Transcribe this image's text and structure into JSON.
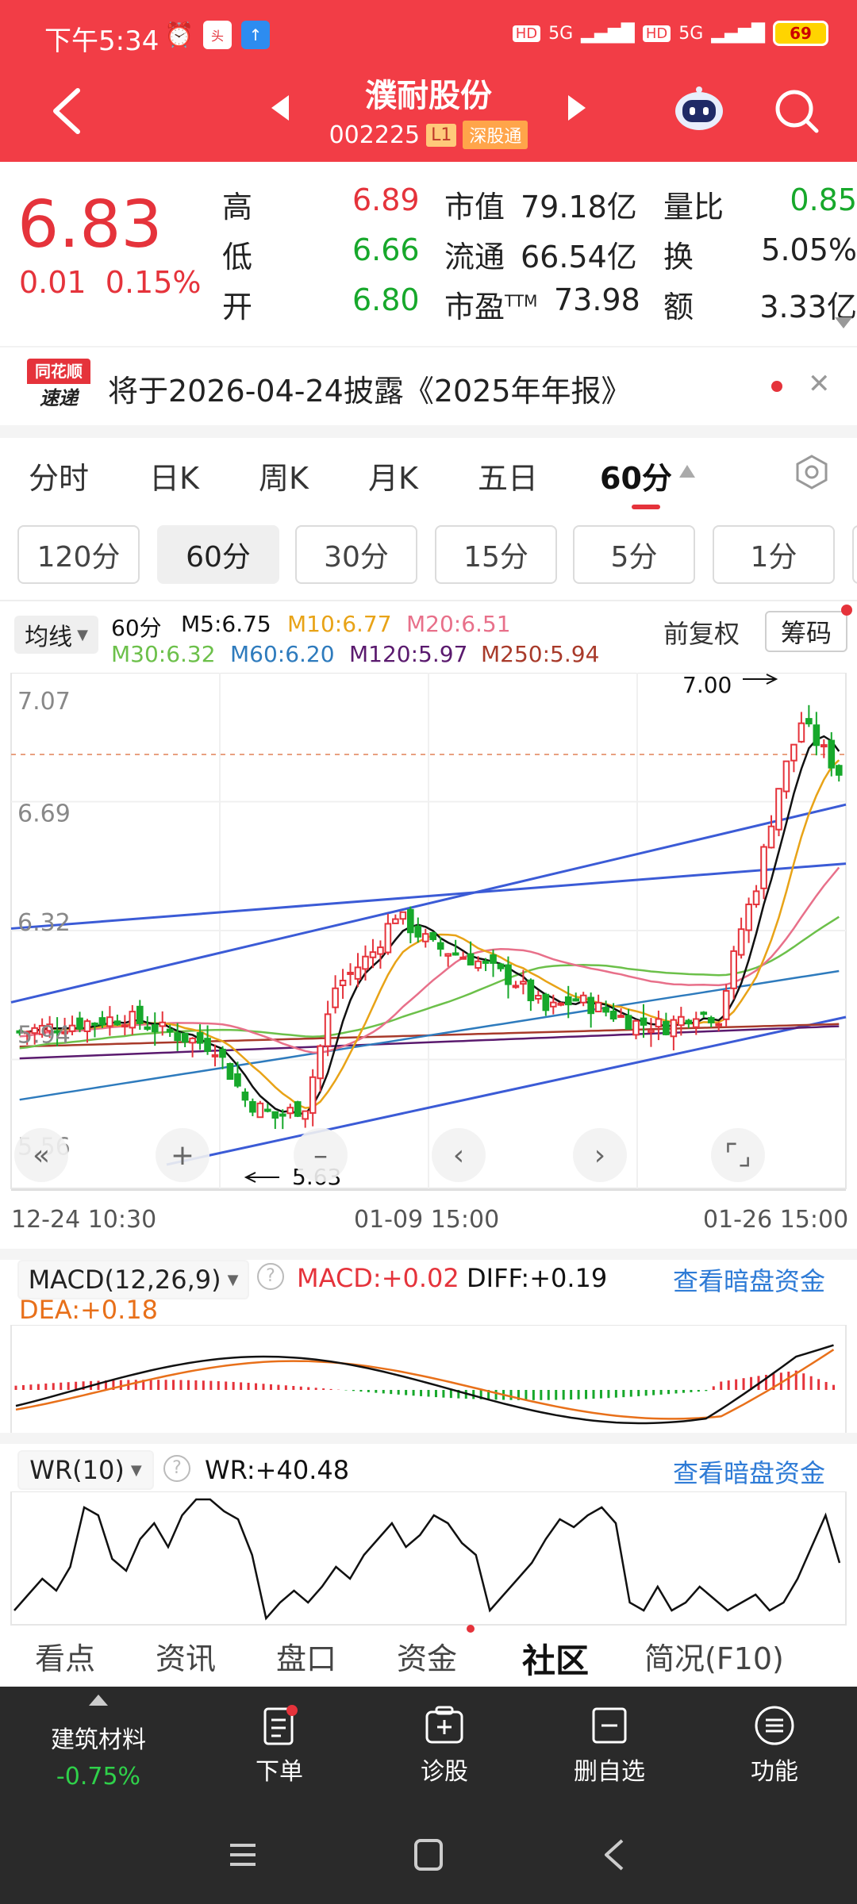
{
  "status_bar": {
    "time": "下午5:34",
    "signal1": "5G",
    "signal2": "5G",
    "battery": "69"
  },
  "header": {
    "title": "濮耐股份",
    "code": "002225",
    "level_badge": "L1",
    "exchange_badge": "深股通"
  },
  "quote": {
    "price": "6.83",
    "change": "0.01",
    "change_pct": "0.15%",
    "high_label": "高",
    "high": "6.89",
    "low_label": "低",
    "low": "6.66",
    "open_label": "开",
    "open": "6.80",
    "mktcap_label": "市值",
    "mktcap": "79.18亿",
    "float_label": "流通",
    "float": "66.54亿",
    "pe_label": "市盈",
    "pe_sup": "TTM",
    "pe": "73.98",
    "volratio_label": "量比",
    "volratio": "0.85",
    "turnover_label": "换",
    "turnover": "5.05%",
    "amount_label": "额",
    "amount": "3.33亿"
  },
  "notice": {
    "logo_top": "同花顺",
    "logo_bottom": "速递",
    "text": "将于2026-04-24披露《2025年年报》"
  },
  "period_tabs": [
    "分时",
    "日K",
    "周K",
    "月K",
    "五日",
    "60分"
  ],
  "sub_tabs": [
    "120分",
    "60分",
    "30分",
    "15分",
    "5分",
    "1分"
  ],
  "legend": {
    "avg_label": "均线",
    "period": "60分",
    "m5": "M5:6.75",
    "m10": "M10:6.77",
    "m20": "M20:6.51",
    "m30": "M30:6.32",
    "m60": "M60:6.20",
    "m120": "M120:5.97",
    "m250": "M250:5.94",
    "adjust": "前复权",
    "chips": "筹码"
  },
  "kline": {
    "yticks": [
      "7.07",
      "6.69",
      "6.32",
      "5.94",
      "5.56"
    ],
    "max_label": "7.00",
    "min_label": "5.63",
    "xticks": [
      "12-24 10:30",
      "01-09 15:00",
      "01-26 15:00"
    ],
    "colors": {
      "up": "#e5333b",
      "down": "#17a82b",
      "m5": "#111111",
      "m10": "#e8a317",
      "m20": "#e8708a",
      "m30": "#6cc04a",
      "m60": "#2e7bbd",
      "m120": "#5a1a6e",
      "m250": "#a83a2a",
      "trend": "#3b5bd6"
    }
  },
  "macd": {
    "label": "MACD(12,26,9)",
    "macd": "MACD:+0.02",
    "diff": "DIFF:+0.19",
    "dea": "DEA:+0.18",
    "link": "查看暗盘资金"
  },
  "wr": {
    "label": "WR(10)",
    "value": "WR:+40.48",
    "link": "查看暗盘资金"
  },
  "bottom_tabs": [
    "看点",
    "资讯",
    "盘口",
    "资金",
    "社区",
    "简况(F10)"
  ],
  "toolbar": {
    "sector": "建筑材料",
    "sector_change": "-0.75%",
    "order": "下单",
    "diagnose": "诊股",
    "remove": "删自选",
    "functions": "功能"
  }
}
